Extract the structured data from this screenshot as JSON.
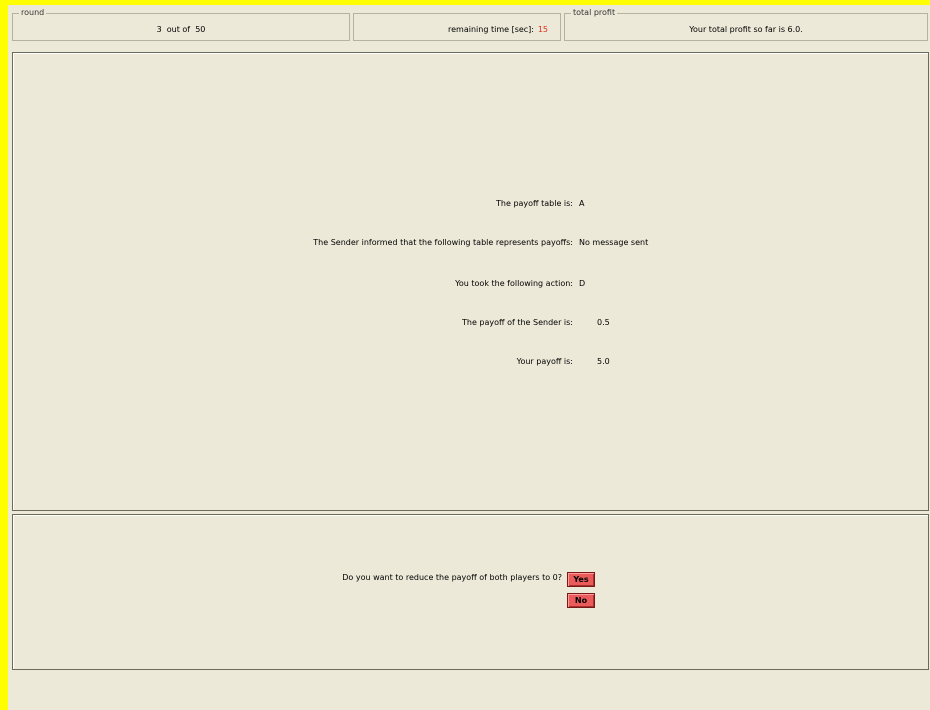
{
  "header": {
    "round_group_title": "round",
    "round_text": "3  out of  50",
    "time_label": "remaining time [sec]:",
    "time_value": "15",
    "profit_group_title": "total profit",
    "profit_text": "Your total profit so far is 6.0."
  },
  "results": {
    "rows": [
      {
        "label": "The payoff table is:",
        "value": "A"
      },
      {
        "label": "The Sender informed that the following table represents payoffs:",
        "value": "No message sent"
      },
      {
        "label": "You took the following action:",
        "value": "D"
      },
      {
        "label": "The payoff of the Sender is:",
        "value": "0.5"
      },
      {
        "label": "Your payoff is:",
        "value": "5.0"
      }
    ]
  },
  "decision": {
    "question": "Do you want to reduce the payoff of both players to 0?",
    "yes_label": "Yes",
    "no_label": "No"
  },
  "colors": {
    "time_value": "#e0301e",
    "button": "#ec5b5b",
    "accent_border": "#ffff00"
  }
}
